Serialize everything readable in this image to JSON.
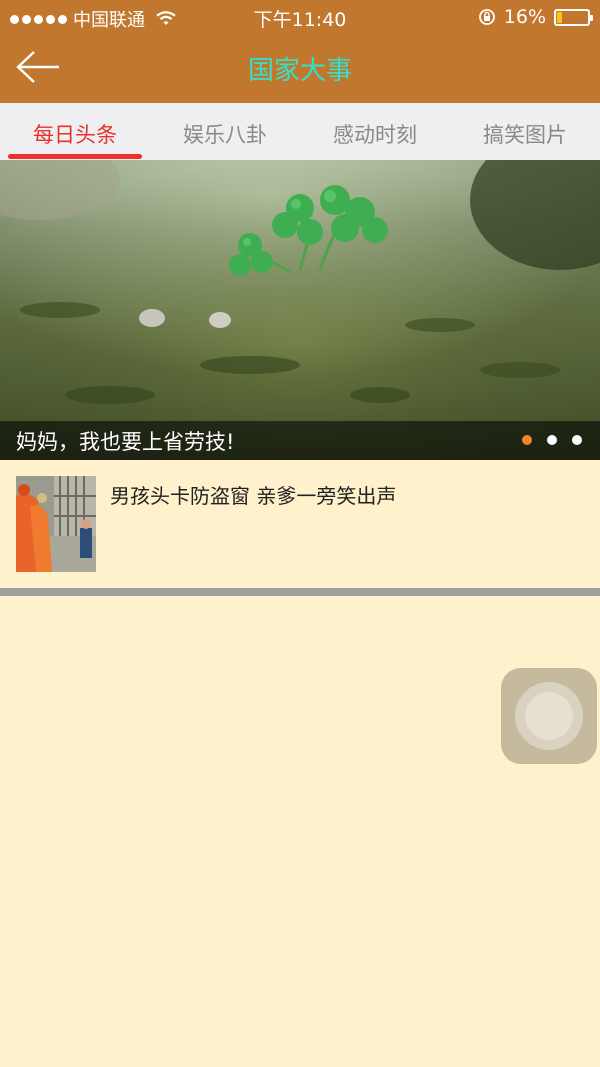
{
  "status_bar": {
    "carrier": "中国联通",
    "time": "下午11:40",
    "battery_percent": "16%",
    "battery_level": 0.16,
    "battery_color": "#F5C518"
  },
  "nav": {
    "title": "国家大事",
    "back_icon": "arrow-left-icon"
  },
  "tabs": [
    {
      "label": "每日头条",
      "active": true
    },
    {
      "label": "娱乐八卦",
      "active": false
    },
    {
      "label": "感动时刻",
      "active": false
    },
    {
      "label": "搞笑图片",
      "active": false
    }
  ],
  "banner": {
    "caption": "妈妈，我也要上省劳技!",
    "slide_count": 3,
    "active_slide": 1
  },
  "news": [
    {
      "title": "男孩头卡防盗窗 亲爹一旁笑出声"
    }
  ],
  "colors": {
    "header_bg": "#C1782E",
    "title": "#35E0C8",
    "tab_active": "#E8322C",
    "page_bg": "#FEF1CC",
    "dot_active": "#F08430"
  }
}
